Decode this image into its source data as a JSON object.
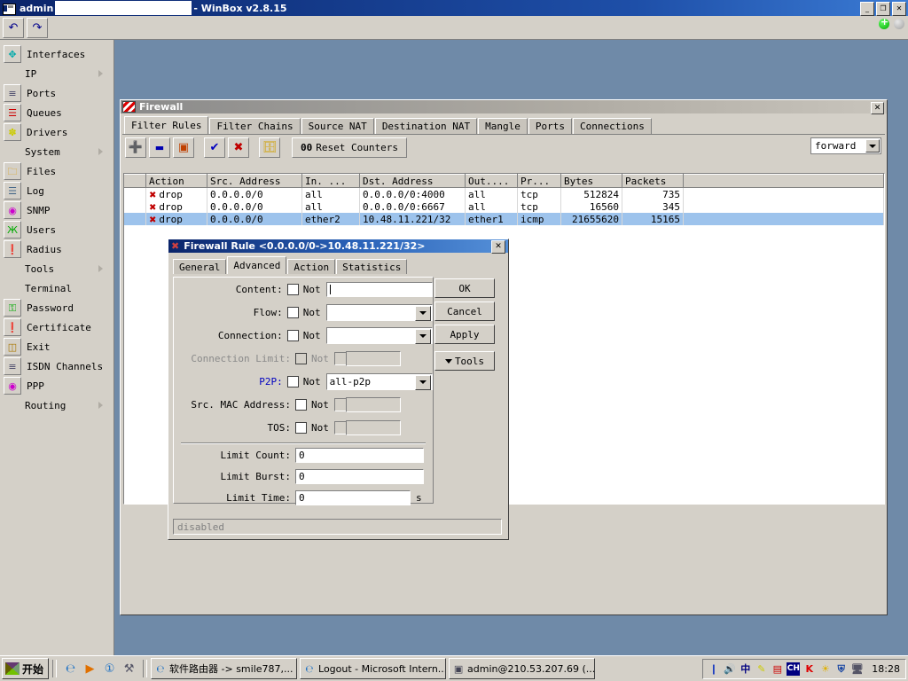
{
  "window": {
    "title_prefix": "admin",
    "title_suffix": "- WinBox v2.8.15",
    "input_value": "",
    "minimize": "_",
    "maximize": "❐",
    "close": "✕",
    "undo_icon": "↺",
    "redo_icon": "↻"
  },
  "sidebar": {
    "items": [
      {
        "label": "Interfaces",
        "icon": "interfaces-icon",
        "glyph": "✥",
        "color": "#0aa",
        "submenu": false
      },
      {
        "label": "IP",
        "icon": "ip-icon",
        "glyph": "",
        "color": "",
        "submenu": true
      },
      {
        "label": "Ports",
        "icon": "ports-icon",
        "glyph": "≡",
        "color": "#446",
        "submenu": false
      },
      {
        "label": "Queues",
        "icon": "queues-icon",
        "glyph": "☰",
        "color": "#c00",
        "submenu": false
      },
      {
        "label": "Drivers",
        "icon": "drivers-icon",
        "glyph": "✽",
        "color": "#cc0",
        "submenu": false
      },
      {
        "label": "System",
        "icon": "system-icon",
        "glyph": "",
        "color": "",
        "submenu": true
      },
      {
        "label": "Files",
        "icon": "files-icon",
        "glyph": "🗀",
        "color": "#d90",
        "submenu": false
      },
      {
        "label": "Log",
        "icon": "log-icon",
        "glyph": "☰",
        "color": "#468",
        "submenu": false
      },
      {
        "label": "SNMP",
        "icon": "snmp-icon",
        "glyph": "◉",
        "color": "#c0c",
        "submenu": false
      },
      {
        "label": "Users",
        "icon": "users-icon",
        "glyph": "Ж",
        "color": "#0a0",
        "submenu": false
      },
      {
        "label": "Radius",
        "icon": "radius-icon",
        "glyph": "❗",
        "color": "#c00",
        "submenu": false
      },
      {
        "label": "Tools",
        "icon": "tools-icon",
        "glyph": "",
        "color": "",
        "submenu": true
      },
      {
        "label": "Terminal",
        "icon": "terminal-icon",
        "glyph": "",
        "color": "",
        "submenu": false
      },
      {
        "label": "Password",
        "icon": "password-icon",
        "glyph": "⚿",
        "color": "#0a0",
        "submenu": false
      },
      {
        "label": "Certificate",
        "icon": "certificate-icon",
        "glyph": "❗",
        "color": "#c00",
        "submenu": false
      },
      {
        "label": "Exit",
        "icon": "exit-icon",
        "glyph": "◫",
        "color": "#a70",
        "submenu": false
      },
      {
        "label": "ISDN Channels",
        "icon": "isdn-icon",
        "glyph": "≡",
        "color": "#446",
        "submenu": false
      },
      {
        "label": "PPP",
        "icon": "ppp-icon",
        "glyph": "◉",
        "color": "#c0c",
        "submenu": false
      },
      {
        "label": "Routing",
        "icon": "routing-icon",
        "glyph": "",
        "color": "",
        "submenu": true
      }
    ]
  },
  "firewall": {
    "title": "Firewall",
    "close_label": "✕",
    "tabs": [
      {
        "label": "Filter Rules",
        "active": true
      },
      {
        "label": "Filter Chains",
        "active": false
      },
      {
        "label": "Source NAT",
        "active": false
      },
      {
        "label": "Destination NAT",
        "active": false
      },
      {
        "label": "Mangle",
        "active": false
      },
      {
        "label": "Ports",
        "active": false
      },
      {
        "label": "Connections",
        "active": false
      }
    ],
    "toolbar": {
      "add": "✚",
      "remove": "➖",
      "edit": "◰",
      "enable": "✔",
      "disable": "✖",
      "comment": "🗀",
      "reset_counters_prefix": "00",
      "reset_counters_label": "Reset Counters"
    },
    "chain_filter": {
      "value": "forward"
    },
    "columns": [
      "",
      "Action",
      "Src. Address",
      "In. ...",
      "Dst. Address",
      "Out....",
      "Pr...",
      "Bytes",
      "Packets",
      ""
    ],
    "rows": [
      {
        "flag": "",
        "action": "drop",
        "src": "0.0.0.0/0",
        "in": "all",
        "dst": "0.0.0.0/0:4000",
        "out": "all",
        "proto": "tcp",
        "bytes": "512824",
        "packets": "735",
        "selected": false
      },
      {
        "flag": "",
        "action": "drop",
        "src": "0.0.0.0/0",
        "in": "all",
        "dst": "0.0.0.0/0:6667",
        "out": "all",
        "proto": "tcp",
        "bytes": "16560",
        "packets": "345",
        "selected": false
      },
      {
        "flag": "",
        "action": "drop",
        "src": "0.0.0.0/0",
        "in": "ether2",
        "dst": "10.48.11.221/32",
        "out": "ether1",
        "proto": "icmp",
        "bytes": "21655620",
        "packets": "15165",
        "selected": true
      }
    ]
  },
  "rule_dialog": {
    "title": "Firewall Rule <0.0.0.0/0->10.48.11.221/32>",
    "close_label": "✕",
    "tabs": [
      {
        "label": "General",
        "active": false
      },
      {
        "label": "Advanced",
        "active": true
      },
      {
        "label": "Action",
        "active": false
      },
      {
        "label": "Statistics",
        "active": false
      }
    ],
    "fields": [
      {
        "label": "Content:",
        "not_label": "Not",
        "type": "text",
        "value": "",
        "disabled": false,
        "highlight": false,
        "caret": true
      },
      {
        "label": "Flow:",
        "not_label": "Not",
        "type": "combo",
        "value": "",
        "disabled": false,
        "highlight": false
      },
      {
        "label": "Connection:",
        "not_label": "Not",
        "type": "combo",
        "value": "",
        "disabled": false,
        "highlight": false
      },
      {
        "label": "Connection Limit:",
        "not_label": "Not",
        "type": "split",
        "value": "",
        "disabled": true,
        "highlight": false
      },
      {
        "label": "P2P:",
        "not_label": "Not",
        "type": "combo",
        "value": "all-p2p",
        "disabled": false,
        "highlight": true
      },
      {
        "label": "Src. MAC Address:",
        "not_label": "Not",
        "type": "split",
        "value": "",
        "disabled": false,
        "highlight": false
      },
      {
        "label": "TOS:",
        "not_label": "Not",
        "type": "split",
        "value": "",
        "disabled": false,
        "highlight": false
      }
    ],
    "limits": [
      {
        "label": "Limit Count:",
        "value": "0",
        "unit": ""
      },
      {
        "label": "Limit Burst:",
        "value": "0",
        "unit": ""
      },
      {
        "label": "Limit Time:",
        "value": "0",
        "unit": "s"
      }
    ],
    "buttons": {
      "ok": "OK",
      "cancel": "Cancel",
      "apply": "Apply",
      "tools": "Tools"
    },
    "status": "disabled"
  },
  "taskbar": {
    "start_label": "开始",
    "quick_launch": [
      {
        "name": "ie-icon",
        "glyph": "℮",
        "color": "#1a6fc4"
      },
      {
        "name": "media-player-icon",
        "glyph": "▶",
        "color": "#e07000"
      },
      {
        "name": "info-icon",
        "glyph": "①",
        "color": "#1a6fc4"
      },
      {
        "name": "desktop-icon",
        "glyph": "⚒",
        "color": "#556"
      }
    ],
    "tasks": [
      {
        "label": "软件路由器 -> smile787,...",
        "icon": "ie-icon"
      },
      {
        "label": "Logout - Microsoft Intern...",
        "icon": "ie-icon"
      },
      {
        "label": "admin@210.53.207.69 (...",
        "icon": "winbox-icon"
      }
    ],
    "tray": [
      {
        "name": "battery-icon",
        "glyph": "❙",
        "color": "#2040c0"
      },
      {
        "name": "volume-icon",
        "glyph": "🔊",
        "color": "#808080"
      },
      {
        "name": "ime-chinese-icon",
        "glyph": "中",
        "color": "#000080"
      },
      {
        "name": "ime-pen-icon",
        "glyph": "✎",
        "color": "#cc0"
      },
      {
        "name": "ime-toolbar-icon",
        "glyph": "▤",
        "color": "#c00"
      },
      {
        "name": "ime-ch-icon",
        "glyph": "CH",
        "color": "#fff"
      },
      {
        "name": "kaspersky-icon",
        "glyph": "K",
        "color": "#d00"
      },
      {
        "name": "sun-icon",
        "glyph": "☀",
        "color": "#e0b000"
      },
      {
        "name": "shield-icon",
        "glyph": "⛨",
        "color": "#1040a0"
      },
      {
        "name": "network-icon",
        "glyph": "🖥",
        "color": "#556"
      }
    ],
    "clock": "18:28"
  }
}
